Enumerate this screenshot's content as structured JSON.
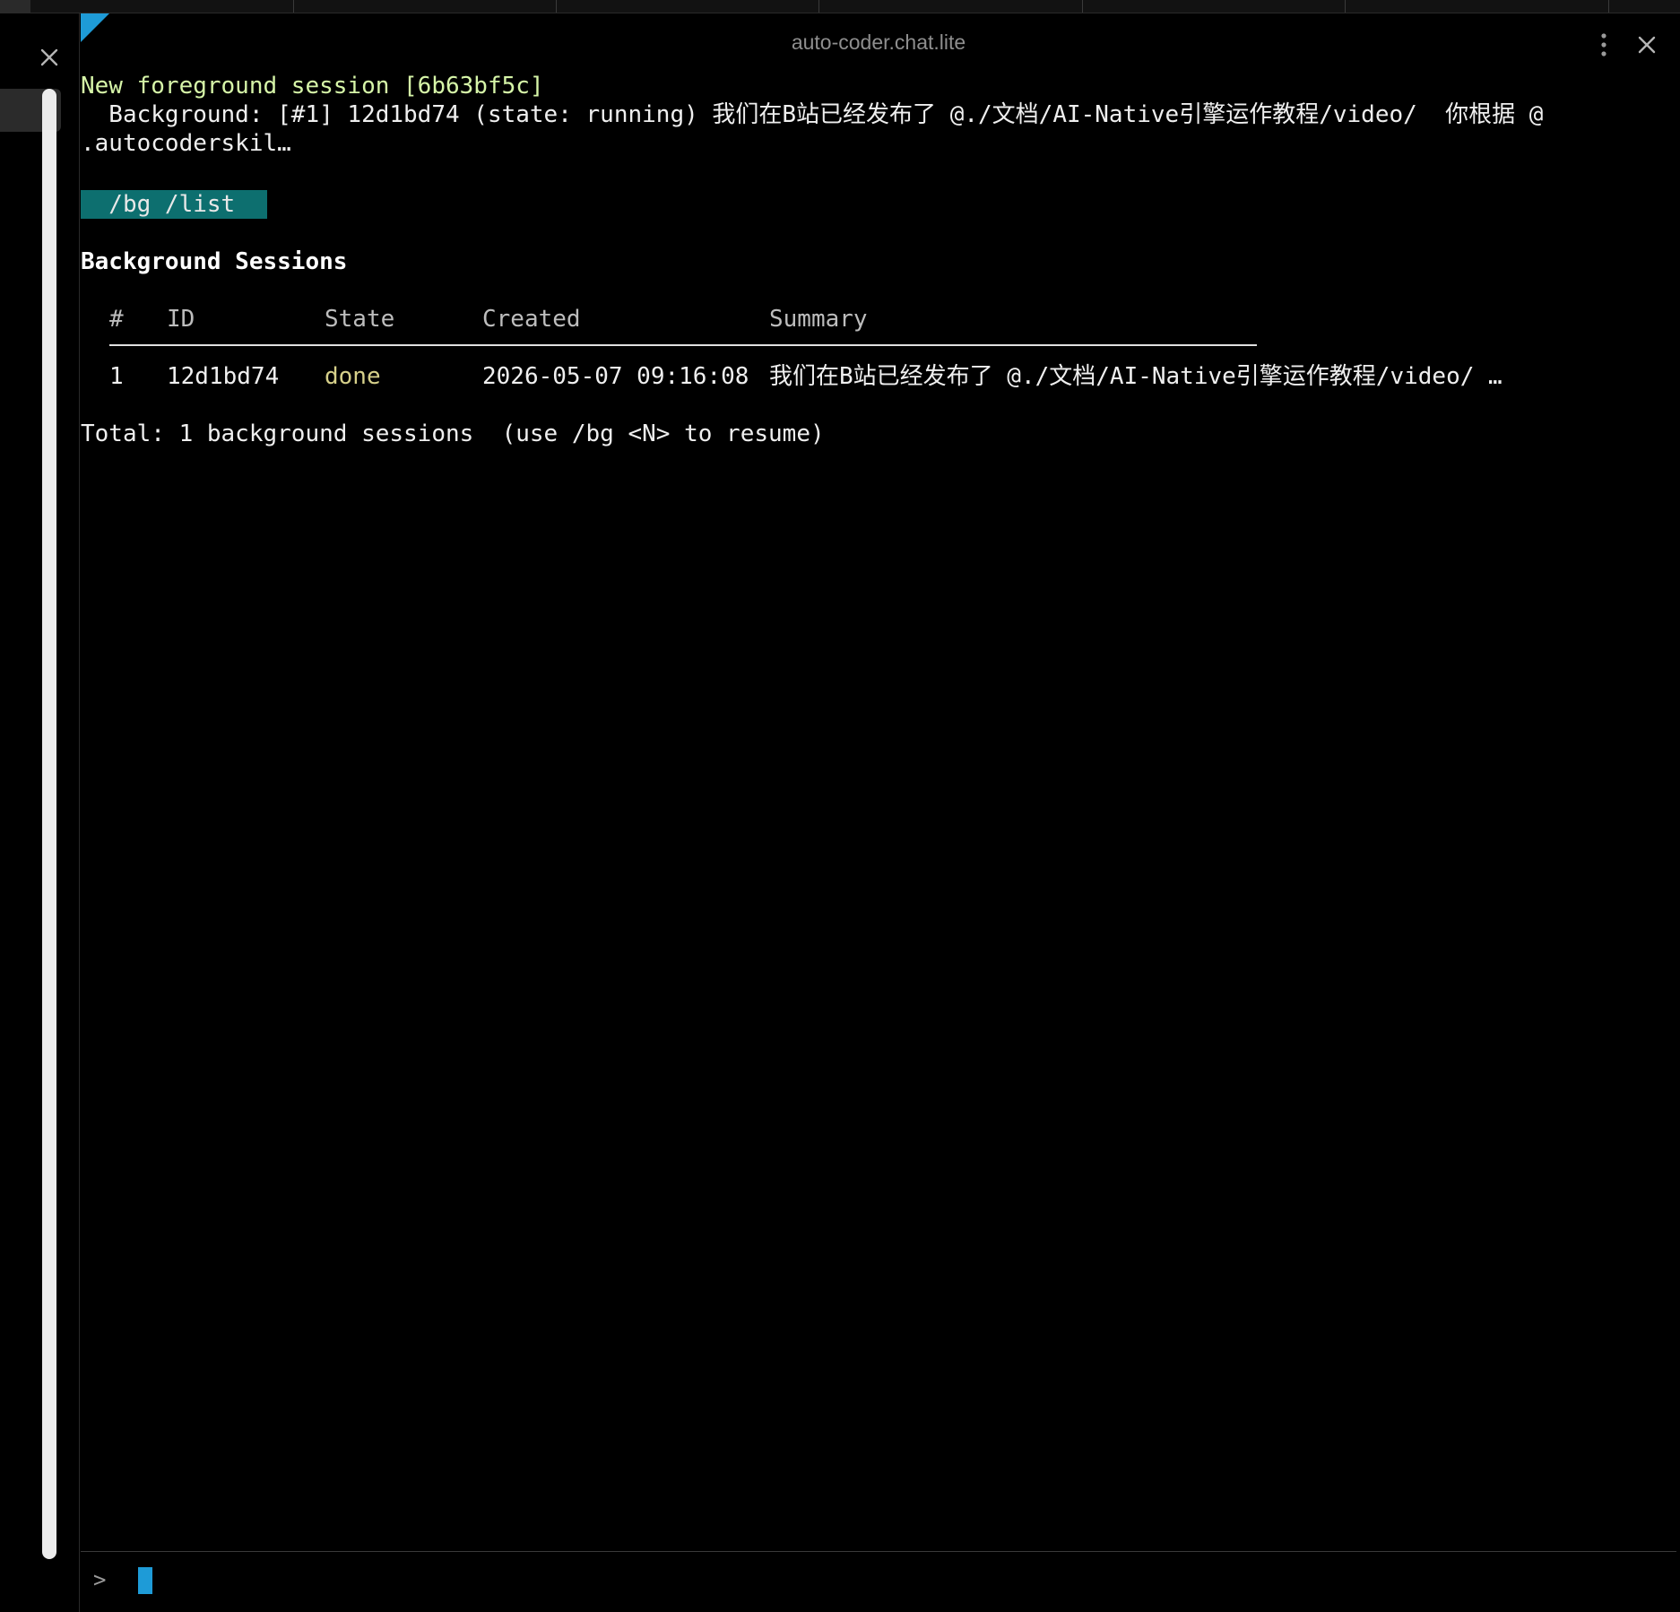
{
  "window": {
    "title": "auto-coder.chat.lite"
  },
  "icons": {
    "gutter_close": "close-icon",
    "menu": "more-vertical-icon",
    "close": "close-icon"
  },
  "colors": {
    "background": "#000000",
    "accent": "#1e9bd7",
    "command_chip": "#0d6f6f",
    "green_text": "#d6f5a8",
    "state_done": "#d6d08a"
  },
  "terminal": {
    "line1": "New foreground session [6b63bf5c]",
    "line2": "  Background: [#1] 12d1bd74 (state: running) 我们在B站已经发布了 @./文档/AI-Native引擎运作教程/video/  你根据 @",
    "line3": ".autocoderskil…",
    "command": "  /bg /list",
    "section_title": "Background Sessions",
    "table": {
      "headers": {
        "num": "#",
        "id": "ID",
        "state": "State",
        "created": "Created",
        "summary": "Summary"
      },
      "rows": [
        {
          "num": "1",
          "id": "12d1bd74",
          "state": "done",
          "created": "2026-05-07 09:16:08",
          "summary": "我们在B站已经发布了 @./文档/AI-Native引擎运作教程/video/ …"
        }
      ]
    },
    "total": "Total: 1 background sessions  (use /bg <N> to resume)"
  },
  "input": {
    "prompt": ">",
    "value": ""
  }
}
